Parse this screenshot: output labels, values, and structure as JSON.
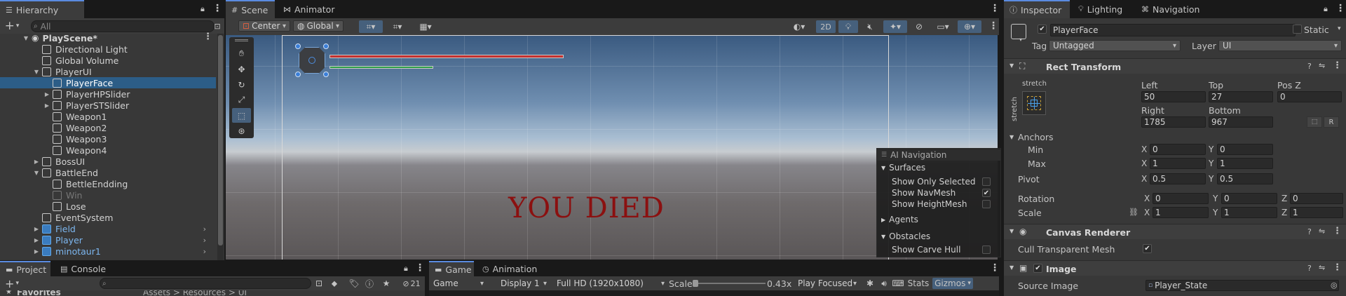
{
  "hierarchy": {
    "tab": "Hierarchy",
    "search_placeholder": "All",
    "add_label": "+",
    "items": [
      {
        "label": "PlayScene*",
        "kind": "scene"
      },
      {
        "label": "Directional Light"
      },
      {
        "label": "Global Volume"
      },
      {
        "label": "PlayerUI"
      },
      {
        "label": "PlayerFace"
      },
      {
        "label": "PlayerHPSlider"
      },
      {
        "label": "PlayerSTSlider"
      },
      {
        "label": "Weapon1"
      },
      {
        "label": "Weapon2"
      },
      {
        "label": "Weapon3"
      },
      {
        "label": "Weapon4"
      },
      {
        "label": "BossUI"
      },
      {
        "label": "BattleEnd"
      },
      {
        "label": "BettleEndding"
      },
      {
        "label": "Win"
      },
      {
        "label": "Lose"
      },
      {
        "label": "EventSystem"
      },
      {
        "label": "Field"
      },
      {
        "label": "Player"
      },
      {
        "label": "minotaur1"
      }
    ]
  },
  "scene": {
    "tabs": [
      "Scene",
      "Animator"
    ],
    "pivot_mode": "Center",
    "space_mode": "Global",
    "mode_2d": "2D",
    "you_died": "YOU DIED"
  },
  "ai_navigation": {
    "title": "AI Navigation",
    "sections": {
      "surfaces": "Surfaces",
      "agents": "Agents",
      "obstacles": "Obstacles"
    },
    "options": {
      "show_only_selected": "Show Only Selected",
      "show_navmesh": "Show NavMesh",
      "show_heightmesh": "Show HeightMesh",
      "show_carve_hull": "Show Carve Hull"
    },
    "checks": {
      "show_only_selected": false,
      "show_navmesh": true,
      "show_heightmesh": false,
      "show_carve_hull": false
    }
  },
  "inspector": {
    "tabs": [
      "Inspector",
      "Lighting",
      "Navigation"
    ],
    "object_name": "PlayerFace",
    "static_label": "Static",
    "tag_label": "Tag",
    "tag_value": "Untagged",
    "layer_label": "Layer",
    "layer_value": "UI",
    "rect_transform": {
      "title": "Rect Transform",
      "anchor_preset_h": "stretch",
      "anchor_preset_v": "stretch",
      "left_label": "Left",
      "left": "50",
      "top_label": "Top",
      "top": "27",
      "posz_label": "Pos Z",
      "posz": "0",
      "right_label": "Right",
      "right": "1785",
      "bottom_label": "Bottom",
      "bottom": "967",
      "r_button": "R",
      "anchors_label": "Anchors",
      "min_label": "Min",
      "min_x": "0",
      "min_y": "0",
      "max_label": "Max",
      "max_x": "1",
      "max_y": "1",
      "pivot_label": "Pivot",
      "pivot_x": "0.5",
      "pivot_y": "0.5",
      "rotation_label": "Rotation",
      "rot_x": "0",
      "rot_y": "0",
      "rot_z": "0",
      "scale_label": "Scale",
      "scale_x": "1",
      "scale_y": "1",
      "scale_z": "1",
      "axis_x": "X",
      "axis_y": "Y",
      "axis_z": "Z"
    },
    "canvas_renderer": {
      "title": "Canvas Renderer",
      "cull_label": "Cull Transparent Mesh"
    },
    "image": {
      "title": "Image",
      "source_label": "Source Image",
      "source_value": "Player_State"
    }
  },
  "bottom_left": {
    "tabs": [
      "Project",
      "Console"
    ],
    "add_label": "+",
    "count": "21",
    "favorites": "Favorites",
    "breadcrumb": "Assets > Resources > UI"
  },
  "game": {
    "tabs": [
      "Game",
      "Animation"
    ],
    "display_mode": "Game",
    "display": "Display 1",
    "resolution": "Full HD (1920x1080)",
    "scale_label": "Scale",
    "scale_value": "0.43x",
    "play_mode": "Play Focused",
    "stats": "Stats",
    "gizmos": "Gizmos"
  },
  "colors": {
    "selection": "#2c5d87",
    "prefab_text": "#7db7f0",
    "you_died": "#8b1010",
    "accent": "#5a8be0"
  }
}
